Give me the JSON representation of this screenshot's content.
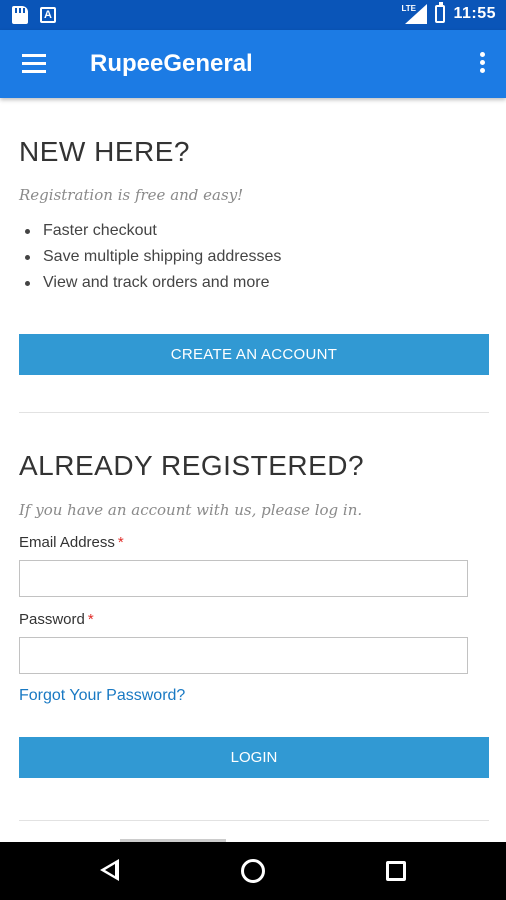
{
  "status_bar": {
    "a_icon_letter": "A",
    "signal_label": "LTE",
    "time": "11:55"
  },
  "app_bar": {
    "title": "RupeeGeneral"
  },
  "new_customer": {
    "heading": "NEW HERE?",
    "subtitle": "Registration is free and easy!",
    "benefits": [
      "Faster checkout",
      "Save multiple shipping addresses",
      "View and track orders and more"
    ],
    "create_button_label": "CREATE AN ACCOUNT"
  },
  "login": {
    "heading": "ALREADY REGISTERED?",
    "subtitle": "If you have an account with us, please log in.",
    "email_label": "Email Address",
    "password_label": "Password",
    "required_marker": "*",
    "email_value": "",
    "password_value": "",
    "forgot_link": "Forgot Your Password?",
    "login_button_label": "LOGIN"
  },
  "colors": {
    "status_bar": "#0a55b8",
    "app_bar": "#1c7be4",
    "button": "#3199d3",
    "link": "#1979c3",
    "required": "#e02b27"
  },
  "icons": {
    "menu": "hamburger-menu-icon",
    "overflow": "more-vertical-icon",
    "nav_back": "back-triangle-icon",
    "nav_home": "home-circle-icon",
    "nav_recent": "recent-apps-square-icon"
  }
}
